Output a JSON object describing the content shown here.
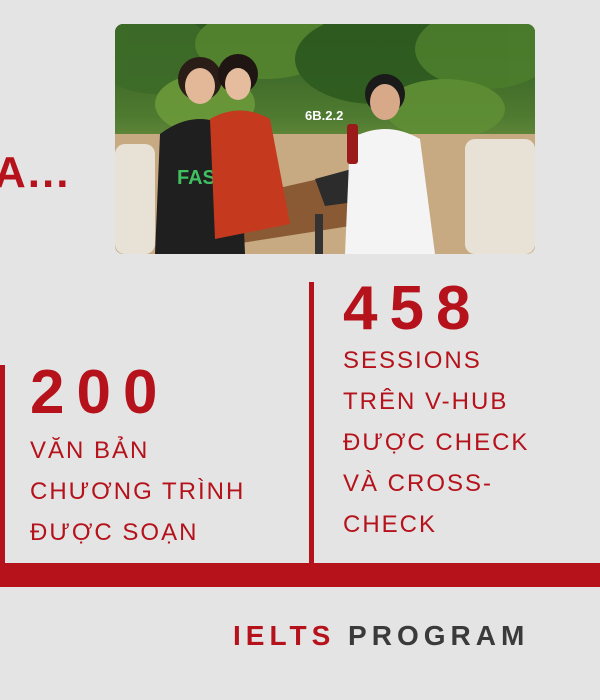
{
  "partial_heading": "A...",
  "photo": {
    "sign_text": "6B.2.2",
    "shirt_text": "FASS"
  },
  "stats": [
    {
      "number": "200",
      "lines": [
        "VĂN BẢN",
        "CHƯƠNG TRÌNH",
        "ĐƯỢC SOẠN"
      ]
    },
    {
      "number": "458",
      "lines": [
        "SESSIONS",
        "TRÊN V-HUB",
        "ĐƯỢC CHECK",
        "VÀ CROSS-",
        "CHECK"
      ]
    }
  ],
  "footer": {
    "word1": "IELTS",
    "word2": "PROGRAM"
  },
  "colors": {
    "accent": "#b5121b",
    "background": "#e4e4e4",
    "dark_text": "#3a3a3a"
  }
}
